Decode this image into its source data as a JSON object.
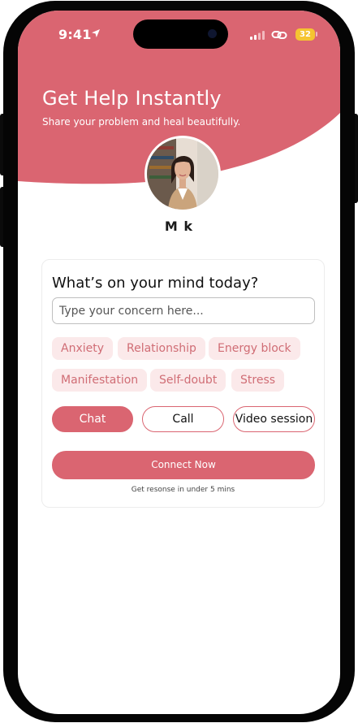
{
  "status_bar": {
    "time": "9:41",
    "battery": "32"
  },
  "header": {
    "title": "Get Help Instantly",
    "subtitle": "Share your problem and heal beautifully."
  },
  "profile": {
    "name": "M k"
  },
  "card": {
    "title": "What’s on your mind today?",
    "input_placeholder": "Type your concern here...",
    "input_value": "",
    "topics": [
      "Anxiety",
      "Relationship",
      "Energy block",
      "Manifestation",
      "Self-doubt",
      "Stress"
    ],
    "modes": [
      "Chat",
      "Call",
      "Video session"
    ],
    "selected_mode": "Chat",
    "connect_label": "Connect Now",
    "response_note": "Get resonse in under 5 mins"
  },
  "colors": {
    "accent": "#da6571",
    "chip_bg": "#fbe9ea",
    "chip_text": "#d06d75"
  }
}
